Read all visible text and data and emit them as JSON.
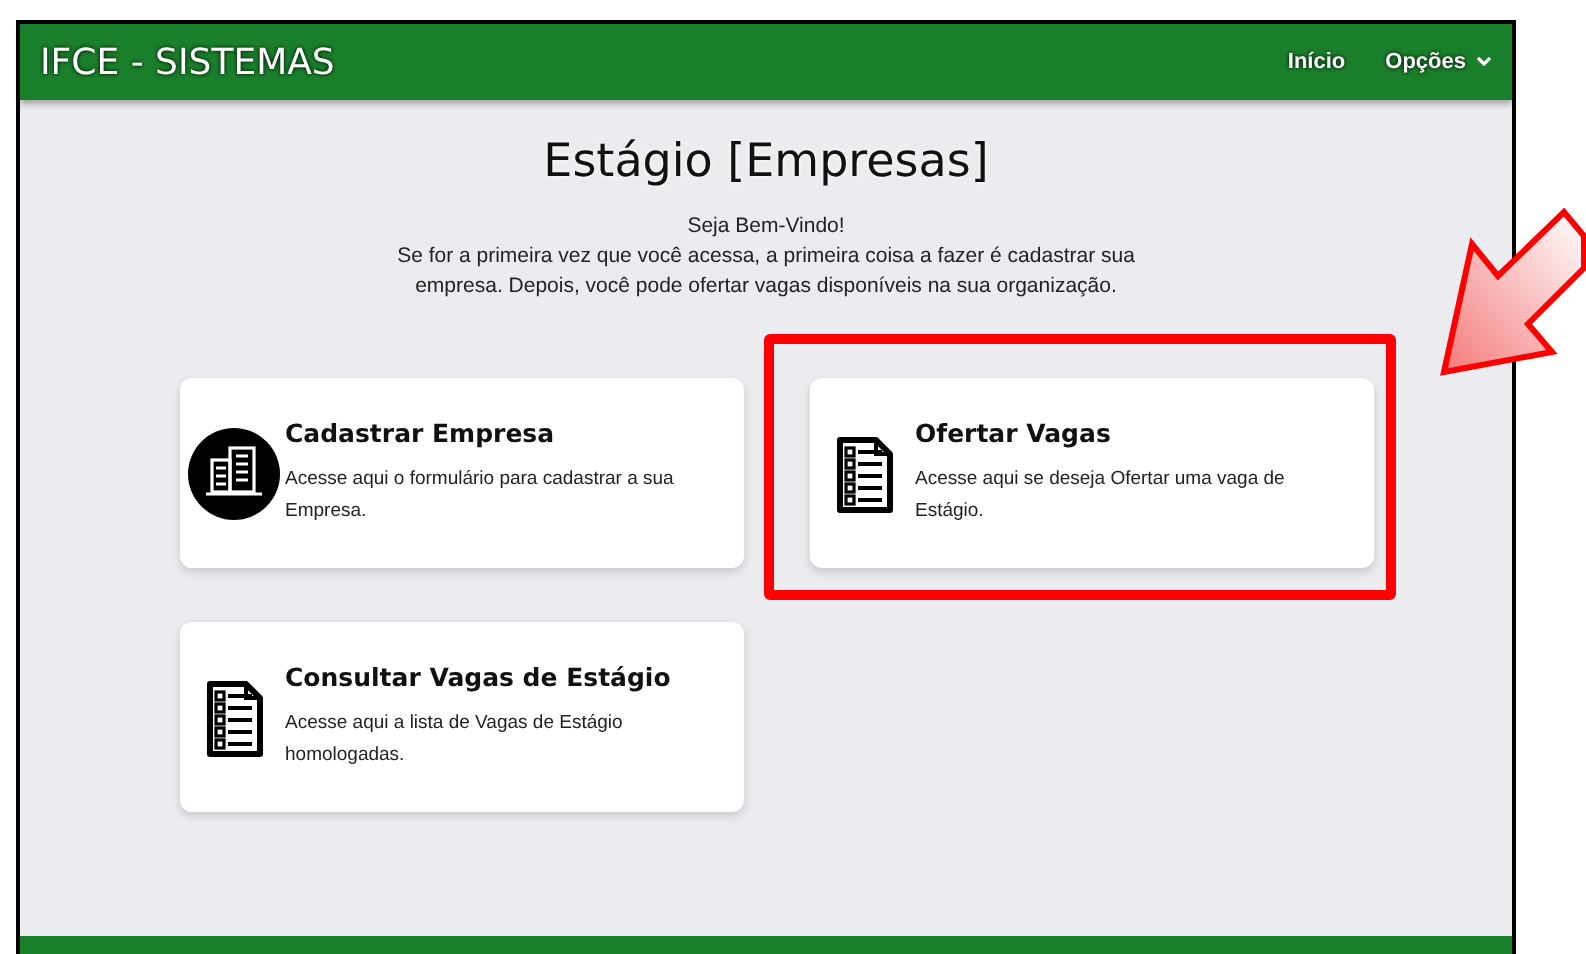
{
  "header": {
    "title": "IFCE - SISTEMAS",
    "nav": [
      {
        "label": "Início",
        "has_caret": false
      },
      {
        "label": "Opções",
        "has_caret": true
      }
    ]
  },
  "heading": "Estágio [Empresas]",
  "welcome": {
    "greeting": "Seja Bem-Vindo!",
    "text": "Se for a primeira vez que você acessa, a primeira coisa a fazer é cadastrar sua empresa. Depois, você pode ofertar vagas disponíveis na sua organização."
  },
  "cards": [
    {
      "title": "Cadastrar Empresa",
      "description": "Acesse aqui o formulário para cadastrar a sua Empresa.",
      "kind": "building",
      "highlighted": false
    },
    {
      "title": "Ofertar Vagas",
      "description": "Acesse aqui se deseja Ofertar uma vaga de Estágio.",
      "kind": "checklist",
      "highlighted": true
    },
    {
      "title": "Consultar Vagas de Estágio",
      "description": "Acesse aqui a lista de Vagas de Estágio homologadas.",
      "kind": "checklist",
      "highlighted": false
    }
  ],
  "annotation": {
    "arrow": true
  }
}
